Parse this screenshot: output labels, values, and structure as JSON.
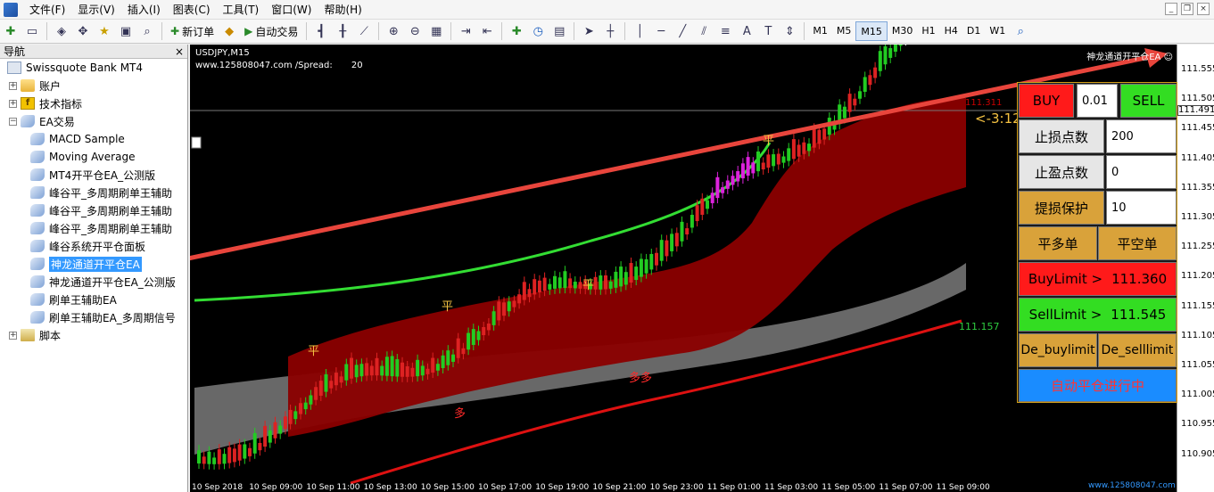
{
  "menu": {
    "items": [
      "文件(F)",
      "显示(V)",
      "插入(I)",
      "图表(C)",
      "工具(T)",
      "窗口(W)",
      "帮助(H)"
    ]
  },
  "toolbar": {
    "new_order_label": "新订单",
    "auto_trade_label": "自动交易",
    "timeframes": [
      "M1",
      "M5",
      "M15",
      "M30",
      "H1",
      "H4",
      "D1",
      "W1"
    ],
    "active_timeframe": "M15"
  },
  "navigator": {
    "title": "导航",
    "close_glyph": "×",
    "root": "Swissquote Bank MT4",
    "groups": {
      "accounts": "账户",
      "indicators": "技术指标",
      "ea": "EA交易",
      "scripts": "脚本"
    },
    "ea_items": [
      "MACD Sample",
      "Moving Average",
      "MT4开平仓EA_公测版",
      "峰谷平_多周期刷单王辅助",
      "峰谷平_多周期刷单王辅助",
      "峰谷平_多周期刷单王辅助",
      "峰谷系统开平仓面板",
      "神龙通道开平仓EA",
      "神龙通道开平仓EA_公测版",
      "刷单王辅助EA",
      "刷单王辅助EA_多周期信号"
    ],
    "selected_index": 7
  },
  "chart": {
    "symbol": "USDJPY,M15",
    "subtitle": "www.125808047.com /Spread:",
    "spread": "20",
    "ea_name": "神龙通道开平仓EA",
    "countdown": "<-3:12",
    "level_upper": "111.311",
    "level_lower": "111.157",
    "current_price": "111.491",
    "price_ticks": [
      "111.555",
      "111.505",
      "111.455",
      "111.405",
      "111.355",
      "111.305",
      "111.255",
      "111.205",
      "111.155",
      "111.105",
      "111.055",
      "111.005",
      "110.955",
      "110.905"
    ],
    "time_ticks": [
      "10 Sep 2018",
      "10 Sep 09:00",
      "10 Sep 11:00",
      "10 Sep 13:00",
      "10 Sep 15:00",
      "10 Sep 17:00",
      "10 Sep 19:00",
      "10 Sep 21:00",
      "10 Sep 23:00",
      "11 Sep 01:00",
      "11 Sep 03:00",
      "11 Sep 05:00",
      "11 Sep 07:00",
      "11 Sep 09:00"
    ],
    "signal_labels": [
      "平",
      "平",
      "平",
      "平",
      "多",
      "多多"
    ],
    "colors": {
      "background": "#000000",
      "upper_band": "#8b0000",
      "lower_band": "#7a7a7a",
      "bull": "#22cc22",
      "bear": "#dd2222",
      "ma_green": "#33dd33",
      "ma_red": "#dd1111",
      "arrow": "#e8453c"
    }
  },
  "ea_panel": {
    "buy_label": "BUY",
    "lot_value": "0.01",
    "sell_label": "SELL",
    "stop_loss_label": "止损点数",
    "stop_loss_value": "200",
    "take_profit_label": "止盈点数",
    "take_profit_value": "0",
    "trailing_label": "提损保护",
    "trailing_value": "10",
    "close_long_label": "平多单",
    "close_short_label": "平空单",
    "buy_limit_label": "BuyLimit >",
    "buy_limit_value": "111.360",
    "sell_limit_label": "SellLimit >",
    "sell_limit_value": "111.545",
    "del_buy_limit_label": "De_buylimit",
    "del_sell_limit_label": "De_selllimit",
    "auto_close_label": "自动平仓进行中",
    "colors": {
      "buy_bg": "#ff1a1a",
      "sell_bg": "#33dd22",
      "limit_buy_bg": "#ff1a1a",
      "limit_sell_bg": "#33dd22",
      "auto_bg": "#1a8cff",
      "auto_text": "#ff3333"
    }
  },
  "watermark": "www.125808047.com"
}
